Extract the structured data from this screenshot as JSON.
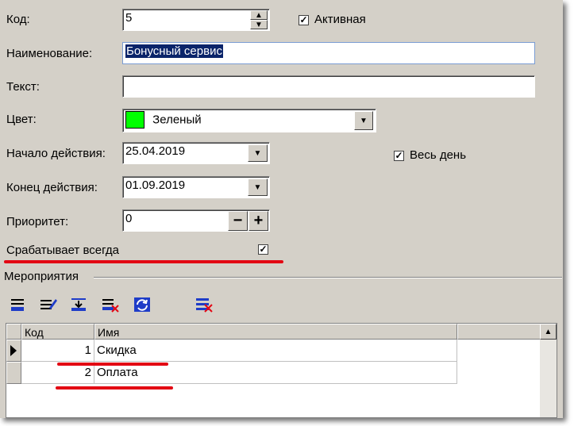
{
  "form": {
    "code_label": "Код:",
    "code_value": "5",
    "active_label": "Активная",
    "name_label": "Наименование:",
    "name_value": "Бонусный сервис",
    "text_label": "Текст:",
    "text_value": "",
    "color_label": "Цвет:",
    "color_value": "Зеленый",
    "color_swatch": "#00ff00",
    "start_label": "Начало действия:",
    "start_value": "25.04.2019",
    "all_day_label": "Весь день",
    "end_label": "Конец действия:",
    "end_value": "01.09.2019",
    "priority_label": "Приоритет:",
    "priority_value": "0",
    "always_label": "Срабатывает всегда"
  },
  "events": {
    "group_label": "Мероприятия",
    "columns": [
      "Код",
      "Имя"
    ],
    "rows": [
      {
        "code": "1",
        "name": "Скидка"
      },
      {
        "code": "2",
        "name": "Оплата"
      }
    ]
  },
  "colors": {
    "window_bg": "#d4d0c8",
    "highlight_red": "#e30613",
    "selection": "#0a246a"
  }
}
